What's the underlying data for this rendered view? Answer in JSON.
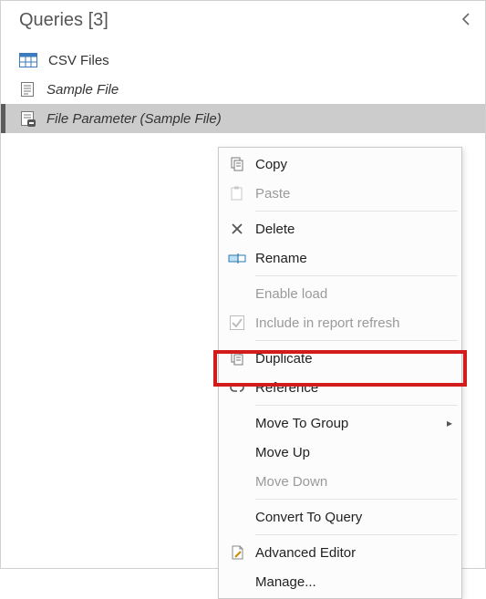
{
  "header": {
    "title": "Queries [3]"
  },
  "queries": [
    {
      "label": "CSV Files",
      "icon": "table-icon",
      "italic": false,
      "selected": false
    },
    {
      "label": "Sample File",
      "icon": "document-icon",
      "italic": true,
      "selected": false
    },
    {
      "label": "File Parameter (Sample File)",
      "icon": "parameter-icon",
      "italic": true,
      "selected": true
    }
  ],
  "contextMenu": {
    "items": [
      {
        "label": "Copy",
        "icon": "copy-icon",
        "disabled": false
      },
      {
        "label": "Paste",
        "icon": "paste-icon",
        "disabled": true
      },
      {
        "sep": true
      },
      {
        "label": "Delete",
        "icon": "delete-icon",
        "disabled": false
      },
      {
        "label": "Rename",
        "icon": "rename-icon",
        "disabled": false
      },
      {
        "sep": true
      },
      {
        "label": "Enable load",
        "icon": "",
        "disabled": true
      },
      {
        "label": "Include in report refresh",
        "icon": "checked-icon",
        "disabled": true
      },
      {
        "sep": true
      },
      {
        "label": "Duplicate",
        "icon": "duplicate-icon",
        "disabled": false
      },
      {
        "label": "Reference",
        "icon": "reference-icon",
        "disabled": false,
        "highlighted": true
      },
      {
        "sep": true
      },
      {
        "label": "Move To Group",
        "icon": "",
        "disabled": false,
        "submenu": true
      },
      {
        "label": "Move Up",
        "icon": "",
        "disabled": false
      },
      {
        "label": "Move Down",
        "icon": "",
        "disabled": true
      },
      {
        "sep": true
      },
      {
        "label": "Convert To Query",
        "icon": "",
        "disabled": false
      },
      {
        "sep": true
      },
      {
        "label": "Advanced Editor",
        "icon": "advanced-editor-icon",
        "disabled": false
      },
      {
        "label": "Manage...",
        "icon": "",
        "disabled": false
      }
    ]
  }
}
